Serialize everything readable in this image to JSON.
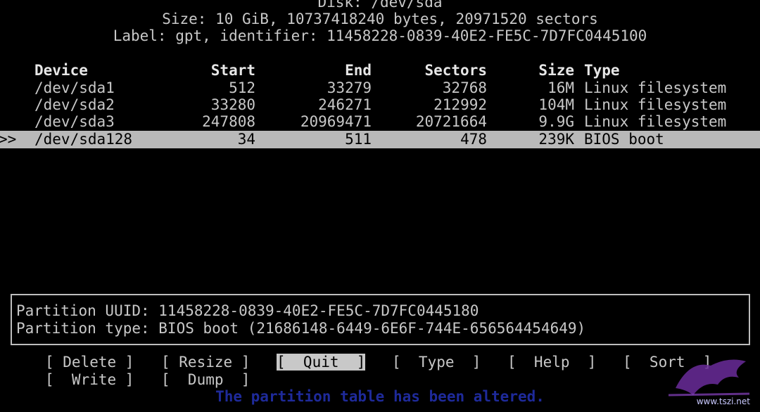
{
  "disk": {
    "title": "Disk: /dev/sda",
    "size_line": "Size: 10 GiB, 10737418240 bytes, 20971520 sectors",
    "label_line": "Label: gpt, identifier: 11458228-0839-40E2-FE5C-7D7FC0445100"
  },
  "table": {
    "headers": [
      "Device",
      "Start",
      "End",
      "Sectors",
      "Size",
      "Type"
    ],
    "rows": [
      {
        "device": "/dev/sda1",
        "start": "512",
        "end": "33279",
        "sectors": "32768",
        "size": "16M",
        "type": "Linux filesystem"
      },
      {
        "device": "/dev/sda2",
        "start": "33280",
        "end": "246271",
        "sectors": "212992",
        "size": "104M",
        "type": "Linux filesystem"
      },
      {
        "device": "/dev/sda3",
        "start": "247808",
        "end": "20969471",
        "sectors": "20721664",
        "size": "9.9G",
        "type": "Linux filesystem"
      },
      {
        "device": "/dev/sda128",
        "start": "34",
        "end": "511",
        "sectors": "478",
        "size": "239K",
        "type": "BIOS boot"
      }
    ],
    "selected_marker": ">>"
  },
  "info": {
    "uuid_line": "Partition UUID: 11458228-0839-40E2-FE5C-7D7FC0445180",
    "type_line": "Partition type: BIOS boot (21686148-6449-6E6F-744E-656564454649)"
  },
  "menu": {
    "delete": "[ Delete ]",
    "resize": "[ Resize ]",
    "quit": "[  Quit  ]",
    "type": "[  Type  ]",
    "help": "[  Help  ]",
    "sort": "[  Sort  ]",
    "write": "[  Write ]",
    "dump": "[  Dump  ]"
  },
  "status_message": "The partition table has been altered.",
  "watermark": "www.tszi.net",
  "colors": {
    "background": "#000000",
    "text": "#c8c8c8",
    "selection": "#b9b9b9",
    "status": "#1e2a9a"
  }
}
